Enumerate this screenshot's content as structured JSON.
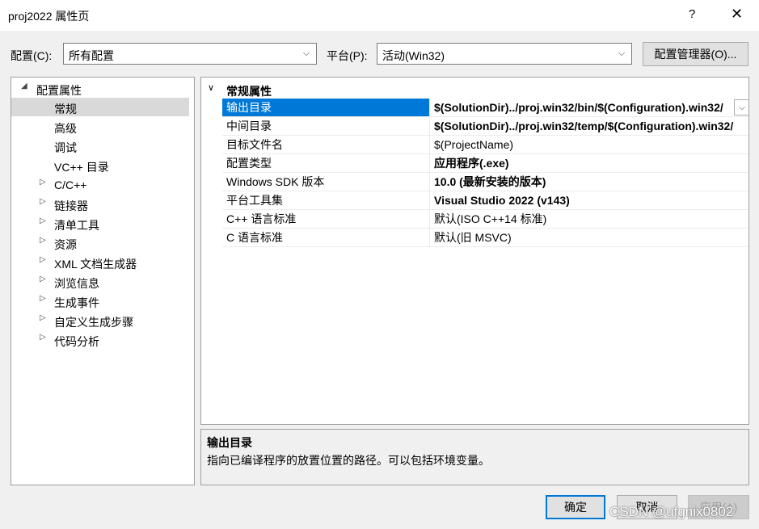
{
  "window": {
    "title": "proj2022 属性页",
    "help_label": "?",
    "close_label": "✕"
  },
  "toolbar": {
    "config_label": "配置(C):",
    "config_value": "所有配置",
    "platform_label": "平台(P):",
    "platform_value": "活动(Win32)",
    "manager_button": "配置管理器(O)...",
    "dropdown_glyph": "⌵"
  },
  "tree": {
    "root": {
      "label": "配置属性",
      "expander": "◢"
    },
    "items": [
      {
        "label": "常规",
        "expander": ""
      },
      {
        "label": "高级",
        "expander": ""
      },
      {
        "label": "调试",
        "expander": ""
      },
      {
        "label": "VC++ 目录",
        "expander": ""
      },
      {
        "label": "C/C++",
        "expander": "▷"
      },
      {
        "label": "链接器",
        "expander": "▷"
      },
      {
        "label": "清单工具",
        "expander": "▷"
      },
      {
        "label": "资源",
        "expander": "▷"
      },
      {
        "label": "XML 文档生成器",
        "expander": "▷"
      },
      {
        "label": "浏览信息",
        "expander": "▷"
      },
      {
        "label": "生成事件",
        "expander": "▷"
      },
      {
        "label": "自定义生成步骤",
        "expander": "▷"
      },
      {
        "label": "代码分析",
        "expander": "▷"
      }
    ]
  },
  "grid": {
    "category": "常规属性",
    "category_expander": "∨",
    "rows": [
      {
        "name": "输出目录",
        "value": "$(SolutionDir)../proj.win32/bin/$(Configuration).win32/"
      },
      {
        "name": "中间目录",
        "value": "$(SolutionDir)../proj.win32/temp/$(Configuration).win32/"
      },
      {
        "name": "目标文件名",
        "value": "$(ProjectName)"
      },
      {
        "name": "配置类型",
        "value": "应用程序(.exe)"
      },
      {
        "name": "Windows SDK 版本",
        "value": "10.0 (最新安装的版本)"
      },
      {
        "name": "平台工具集",
        "value": "Visual Studio 2022 (v143)"
      },
      {
        "name": "C++ 语言标准",
        "value": "默认(ISO C++14 标准)"
      },
      {
        "name": "C 语言标准",
        "value": "默认(旧 MSVC)"
      }
    ]
  },
  "description": {
    "title": "输出目录",
    "text": "指向已编译程序的放置位置的路径。可以包括环境变量。"
  },
  "buttons": {
    "ok": "确定",
    "cancel": "取消",
    "apply": "应用(A)"
  },
  "watermark": "CSDN @ufgnix0802"
}
